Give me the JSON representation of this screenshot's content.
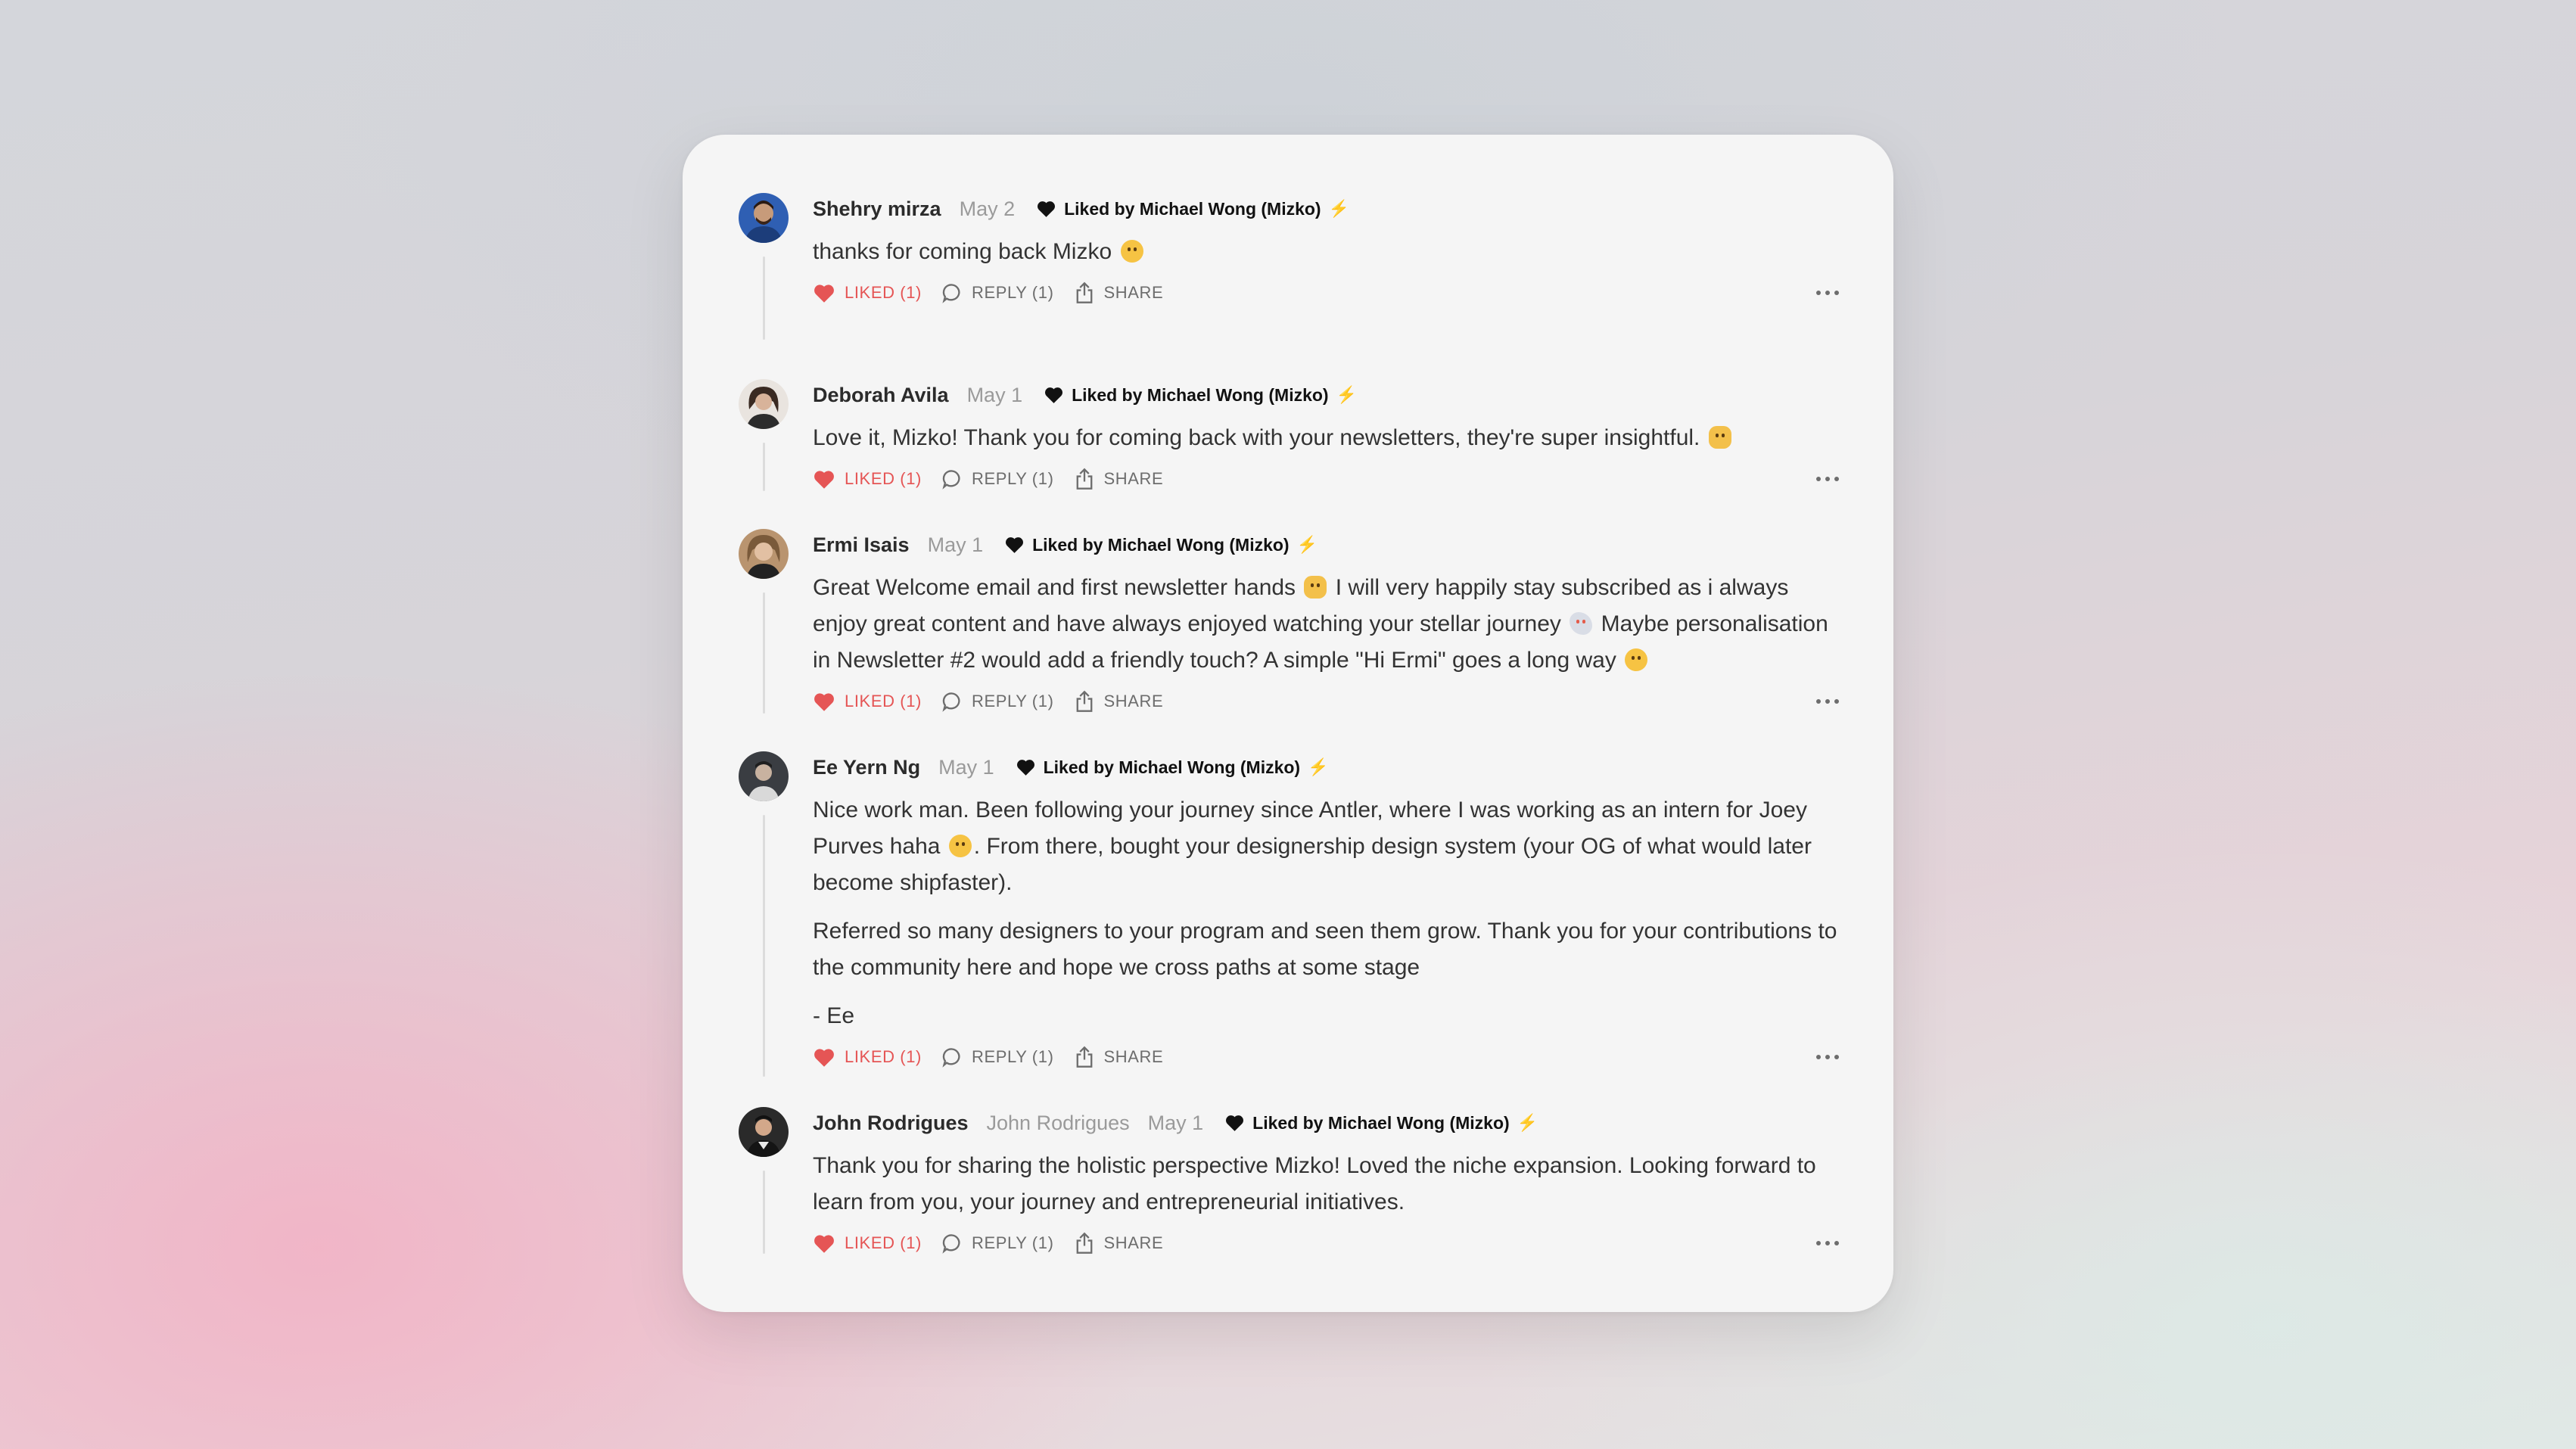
{
  "liked_by_text": "Liked by Michael Wong (Mizko)",
  "colors": {
    "liked": "#e55555",
    "bolt": "#f1b638",
    "card": "#f5f5f5"
  },
  "icons": {
    "like": "heart-icon",
    "reply": "speech-bubble-icon",
    "share": "share-upload-icon",
    "more": "ellipsis-icon",
    "liked_by": "heart-icon",
    "bolt": "lightning-bolt-icon"
  },
  "comments": [
    {
      "author": "Shehry mirza",
      "date": "May 2",
      "paragraphs": [
        "thanks for coming back Mizko"
      ],
      "actions": {
        "like": "LIKED (1)",
        "reply": "REPLY (1)",
        "share": "SHARE"
      }
    },
    {
      "author": "Deborah Avila",
      "date": "May 1",
      "paragraphs": [
        "Love it, Mizko! Thank you for coming back with your newsletters, they're super insightful."
      ],
      "actions": {
        "like": "LIKED (1)",
        "reply": "REPLY (1)",
        "share": "SHARE"
      }
    },
    {
      "author": "Ermi Isais",
      "date": "May 1",
      "paragraphs": [
        "Great Welcome email and first newsletter hands",
        "I will very happily stay subscribed as i always enjoy great content and have always enjoyed watching your stellar journey",
        "Maybe personalisation in Newsletter #2 would add a friendly touch? A simple \"Hi Ermi\" goes a long way"
      ],
      "actions": {
        "like": "LIKED (1)",
        "reply": "REPLY (1)",
        "share": "SHARE"
      }
    },
    {
      "author": "Ee Yern Ng",
      "date": "May 1",
      "paragraphs": [
        "Nice work man. Been following your journey since Antler, where I was working as an intern for Joey Purves haha",
        ". From there, bought your designership design system (your OG of what would later become shipfaster).",
        "Referred so many designers to your program and seen them grow. Thank you for your contributions to the community here and hope we cross paths at some stage",
        "- Ee"
      ],
      "actions": {
        "like": "LIKED (1)",
        "reply": "REPLY (1)",
        "share": "SHARE"
      }
    },
    {
      "author": "John Rodrigues",
      "handle": "John Rodrigues",
      "date": "May 1",
      "paragraphs": [
        "Thank you for sharing the holistic perspective Mizko! Loved the niche expansion. Looking forward to learn from you, your journey and entrepreneurial initiatives."
      ],
      "actions": {
        "like": "LIKED (1)",
        "reply": "REPLY (1)",
        "share": "SHARE"
      }
    }
  ]
}
